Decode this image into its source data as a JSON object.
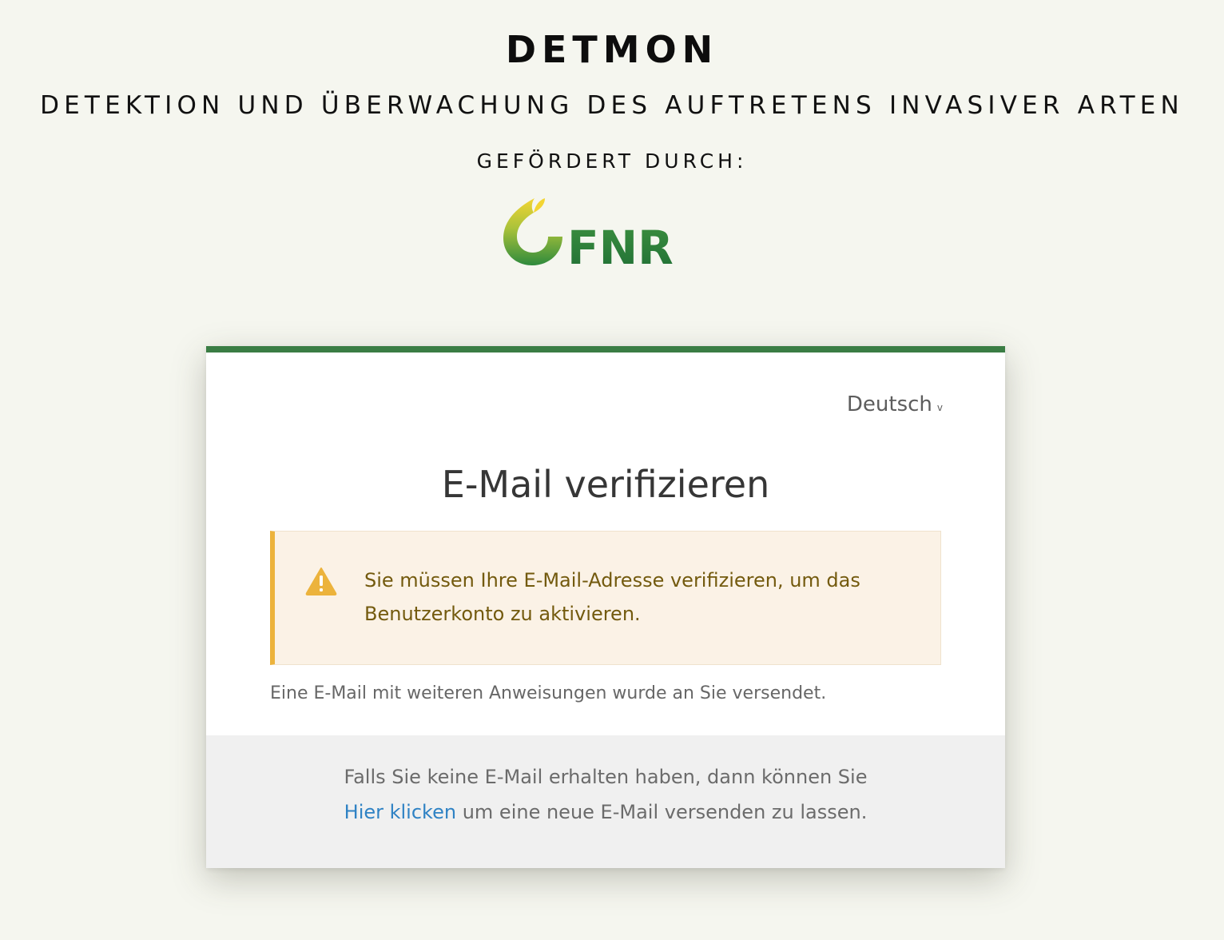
{
  "header": {
    "title": "DETMON",
    "subtitle": "DETEKTION UND ÜBERWACHUNG DES AUFTRETENS INVASIVER ARTEN",
    "funded_by": "GEFÖRDERT DURCH:",
    "logo_text": "FNR"
  },
  "card": {
    "language": "Deutsch",
    "language_chevron": "v",
    "title": "E-Mail verifizieren",
    "alert": {
      "icon": "warning-icon",
      "line1": "Sie müssen Ihre E-Mail-Adresse verifizieren, um das",
      "line2": "Benutzerkonto zu aktivieren."
    },
    "info": "Eine E-Mail mit weiteren Anweisungen wurde an Sie versendet.",
    "footer": {
      "line1": "Falls Sie keine E-Mail erhalten haben, dann können Sie",
      "link": "Hier klicken",
      "line2_rest": " um eine neue E-Mail versenden zu lassen."
    }
  },
  "colors": {
    "background": "#f5f6ef",
    "accent_green": "#3a7d44",
    "warning_border": "#ecb33c",
    "warning_bg": "#fbf2e6",
    "warning_text": "#735a0e",
    "link": "#2f82c4",
    "footer_bg": "#f0f0f0"
  }
}
